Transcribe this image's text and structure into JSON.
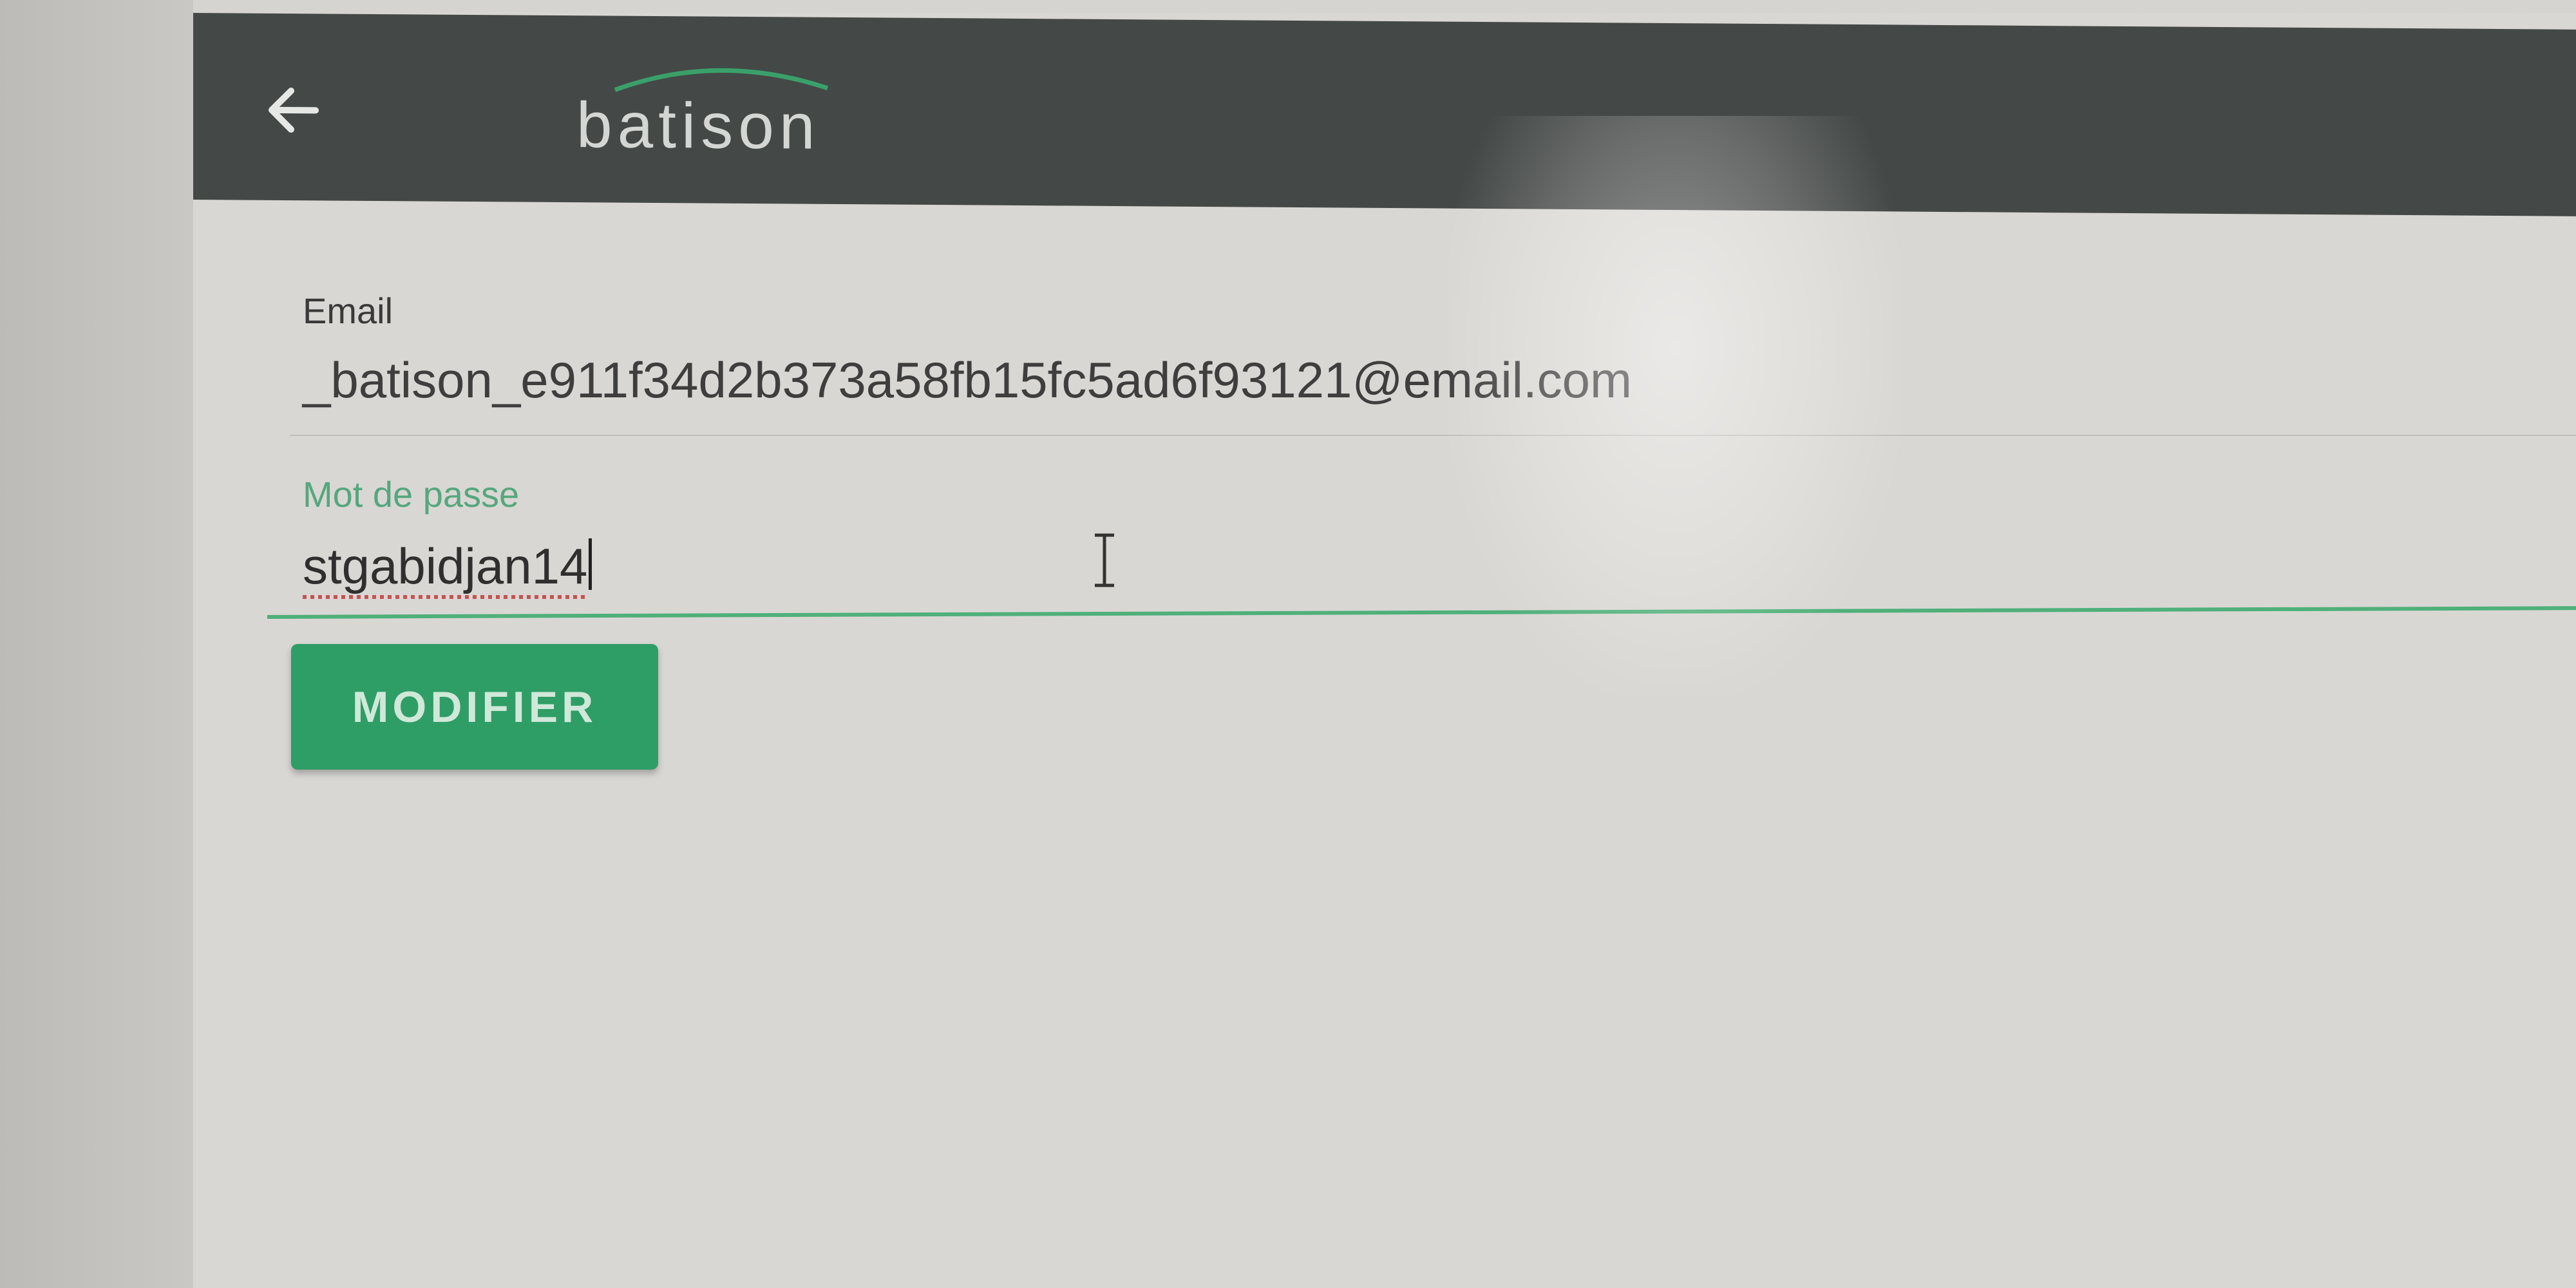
{
  "header": {
    "back_icon": "arrow-left-icon",
    "logo_text": "batison"
  },
  "form": {
    "email": {
      "label": "Email",
      "value": "_batison_e911f34d2b373a58fb15fc5ad6f93121@email.com"
    },
    "password": {
      "label": "Mot de passe",
      "value": "stgabidjan14"
    },
    "submit_label": "MODIFIER"
  },
  "colors": {
    "header_bg": "#444846",
    "accent_green": "#2e9d66",
    "focus_green": "#4fb07a"
  }
}
